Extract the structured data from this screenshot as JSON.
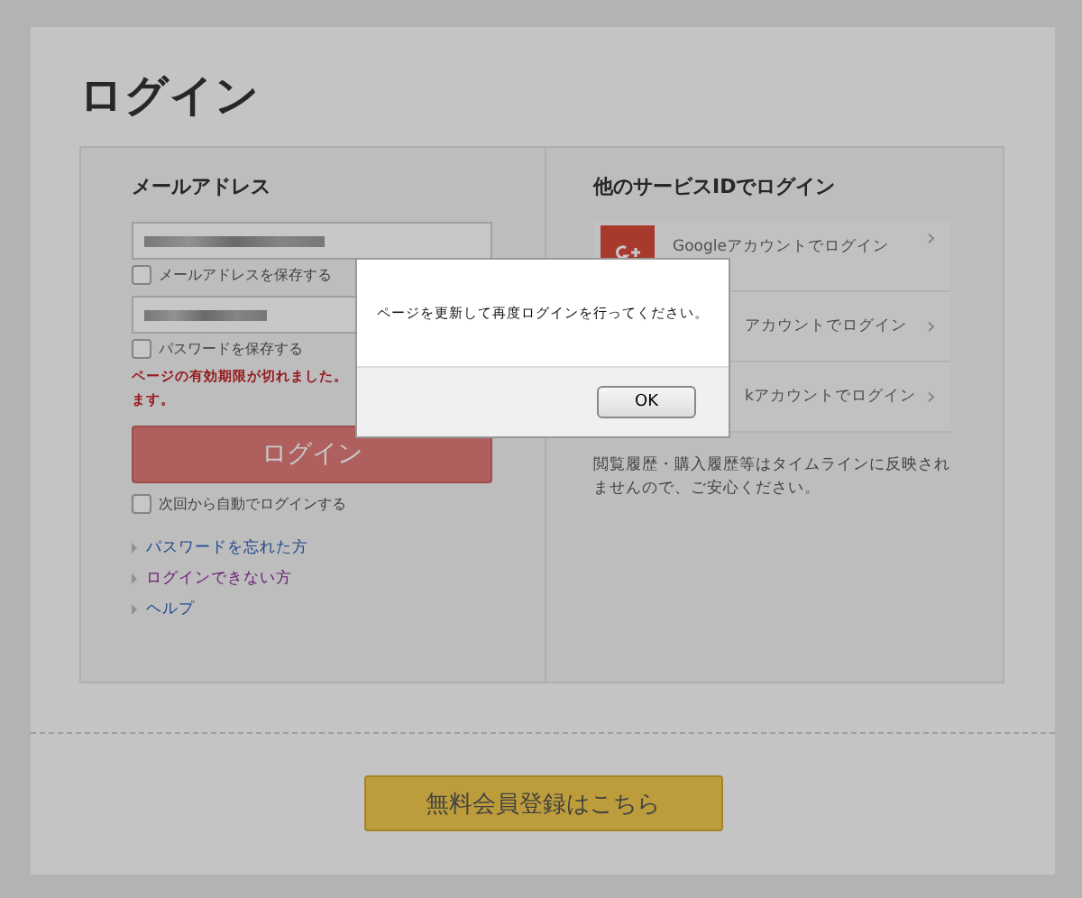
{
  "page_title": "ログイン",
  "login": {
    "heading": "メールアドレス",
    "fields": [
      {
        "kind": "email"
      },
      {
        "kind": "password"
      }
    ],
    "checkboxes": [
      {
        "label": "メールアドレスを保存する",
        "checked": false
      },
      {
        "label": "パスワードを保存する",
        "checked": false
      }
    ],
    "error_lines": [
      "ページの有効期限が切れました。",
      "ます。"
    ],
    "button": "ログイン",
    "auto_login": {
      "label": "次回から自動でログインする",
      "checked": false
    },
    "links": [
      {
        "label": "パスワードを忘れた方",
        "visited": false
      },
      {
        "label": "ログインできない方",
        "visited": true
      },
      {
        "label": "ヘルプ",
        "visited": false
      }
    ]
  },
  "social": {
    "heading": "他のサービスIDでログイン",
    "rows": [
      {
        "kind": "google",
        "label": "Googleアカウントでログイン",
        "arrow": "›"
      },
      {
        "kind": "covered",
        "label": "アカウントでログイン",
        "arrow": "›"
      },
      {
        "kind": "covered_short",
        "label": "kアカウントでログイン",
        "arrow": "›"
      }
    ],
    "note": "閲覧履歴・購入履歴等はタイムラインに反映されませんので、ご安心ください。"
  },
  "register_button": "無料会員登録はこちら",
  "dialog": {
    "message": "ページを更新して再度ログインを行ってください。",
    "button": "OK"
  }
}
